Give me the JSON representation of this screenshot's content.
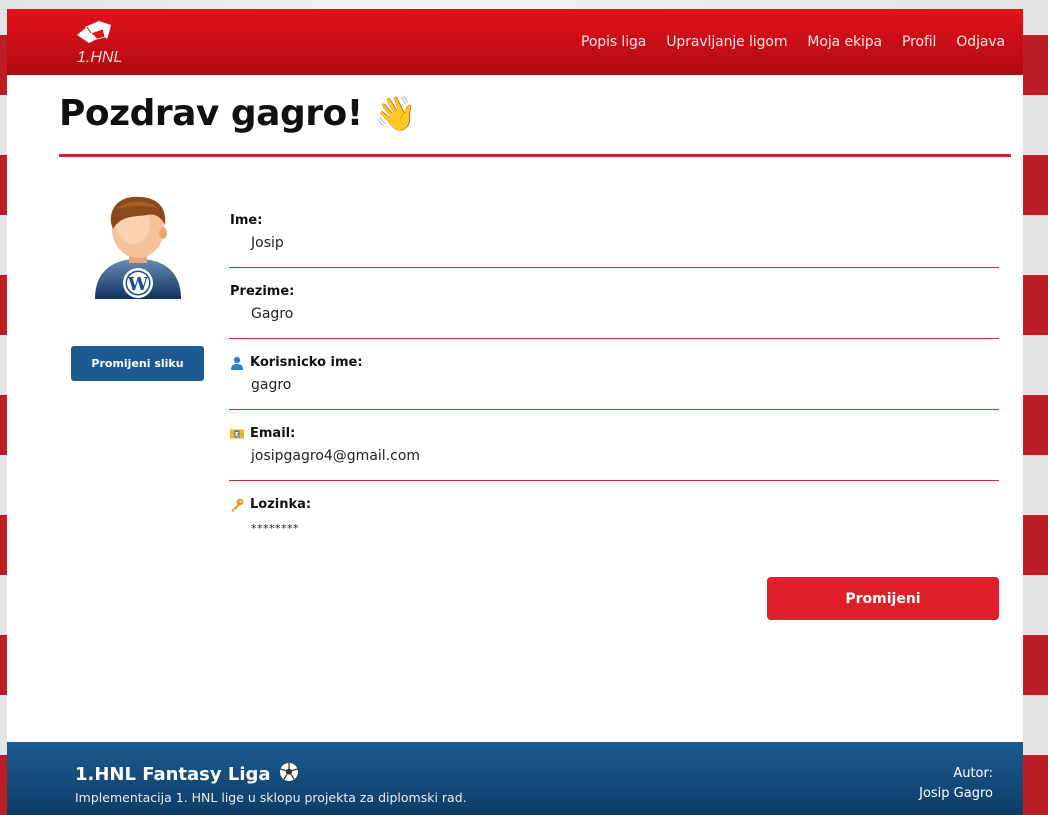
{
  "navbar": {
    "logo_text": "1.HNL",
    "links": [
      "Popis liga",
      "Upravljanje ligom",
      "Moja ekipa",
      "Profil",
      "Odjava"
    ]
  },
  "header": {
    "title": "Pozdrav gagro!",
    "emoji": "👋"
  },
  "profile": {
    "change_picture_label": "Promijeni sliku",
    "fields": [
      {
        "label": "Ime:",
        "value": "Josip",
        "icon": ""
      },
      {
        "label": "Prezime:",
        "value": "Gagro",
        "icon": ""
      },
      {
        "label": "Korisnicko ime:",
        "value": "gagro",
        "icon": "user-icon"
      },
      {
        "label": "Email:",
        "value": "josipgagro4@gmail.com",
        "icon": "email-icon"
      },
      {
        "label": "Lozinka:",
        "value": "********",
        "icon": "key-icon"
      }
    ],
    "edit_label": "Promijeni"
  },
  "footer": {
    "title": "1.HNL Fantasy Liga",
    "subtitle": "Implementacija 1. HNL lige u sklopu projekta za diplomski rad.",
    "author_label": "Autor:",
    "author_name": "Josip Gagro"
  },
  "colors": {
    "navbar_red": "#e3121b",
    "accent_red": "#df1f2a",
    "footer_blue": "#1d5a8f"
  }
}
